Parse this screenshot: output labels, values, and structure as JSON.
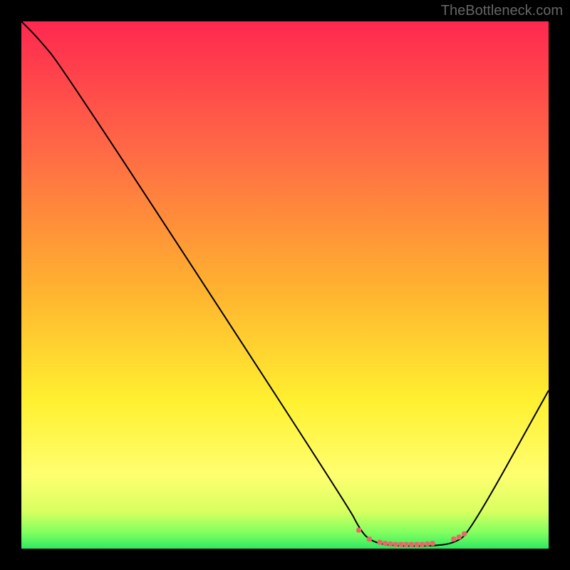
{
  "watermark": "TheBottleneck.com",
  "chart_data": {
    "type": "line",
    "title": "",
    "xlabel": "",
    "ylabel": "",
    "xlim": [
      0,
      100
    ],
    "ylim": [
      0,
      100
    ],
    "background_gradient": {
      "type": "vertical",
      "stops": [
        {
          "offset": 0,
          "color": "#ff2850"
        },
        {
          "offset": 25,
          "color": "#ff6b45"
        },
        {
          "offset": 50,
          "color": "#ffb030"
        },
        {
          "offset": 72,
          "color": "#fff030"
        },
        {
          "offset": 86,
          "color": "#ffff70"
        },
        {
          "offset": 93,
          "color": "#d8ff60"
        },
        {
          "offset": 97,
          "color": "#80ff60"
        },
        {
          "offset": 100,
          "color": "#30e860"
        }
      ]
    },
    "series": [
      {
        "name": "bottleneck-curve",
        "color": "#000000",
        "stroke_width": 2,
        "points": [
          {
            "x": 0,
            "y": 100
          },
          {
            "x": 3,
            "y": 97
          },
          {
            "x": 8,
            "y": 91
          },
          {
            "x": 62,
            "y": 8
          },
          {
            "x": 64,
            "y": 4
          },
          {
            "x": 66,
            "y": 1.5
          },
          {
            "x": 70,
            "y": 0.5
          },
          {
            "x": 78,
            "y": 0.5
          },
          {
            "x": 82,
            "y": 1
          },
          {
            "x": 85,
            "y": 3
          },
          {
            "x": 100,
            "y": 30
          }
        ]
      },
      {
        "name": "optimal-zone-markers",
        "color": "#e86868",
        "type": "scatter",
        "marker_size": 7,
        "points": [
          {
            "x": 64,
            "y": 3.5
          },
          {
            "x": 66,
            "y": 1.8
          },
          {
            "x": 68,
            "y": 1.2
          },
          {
            "x": 69,
            "y": 1.0
          },
          {
            "x": 70,
            "y": 0.9
          },
          {
            "x": 71,
            "y": 0.8
          },
          {
            "x": 72,
            "y": 0.8
          },
          {
            "x": 73,
            "y": 0.8
          },
          {
            "x": 74,
            "y": 0.8
          },
          {
            "x": 75,
            "y": 0.8
          },
          {
            "x": 76,
            "y": 0.8
          },
          {
            "x": 77,
            "y": 0.9
          },
          {
            "x": 78,
            "y": 1.0
          },
          {
            "x": 82,
            "y": 1.8
          },
          {
            "x": 83,
            "y": 2.2
          },
          {
            "x": 84,
            "y": 2.8
          }
        ]
      }
    ]
  }
}
